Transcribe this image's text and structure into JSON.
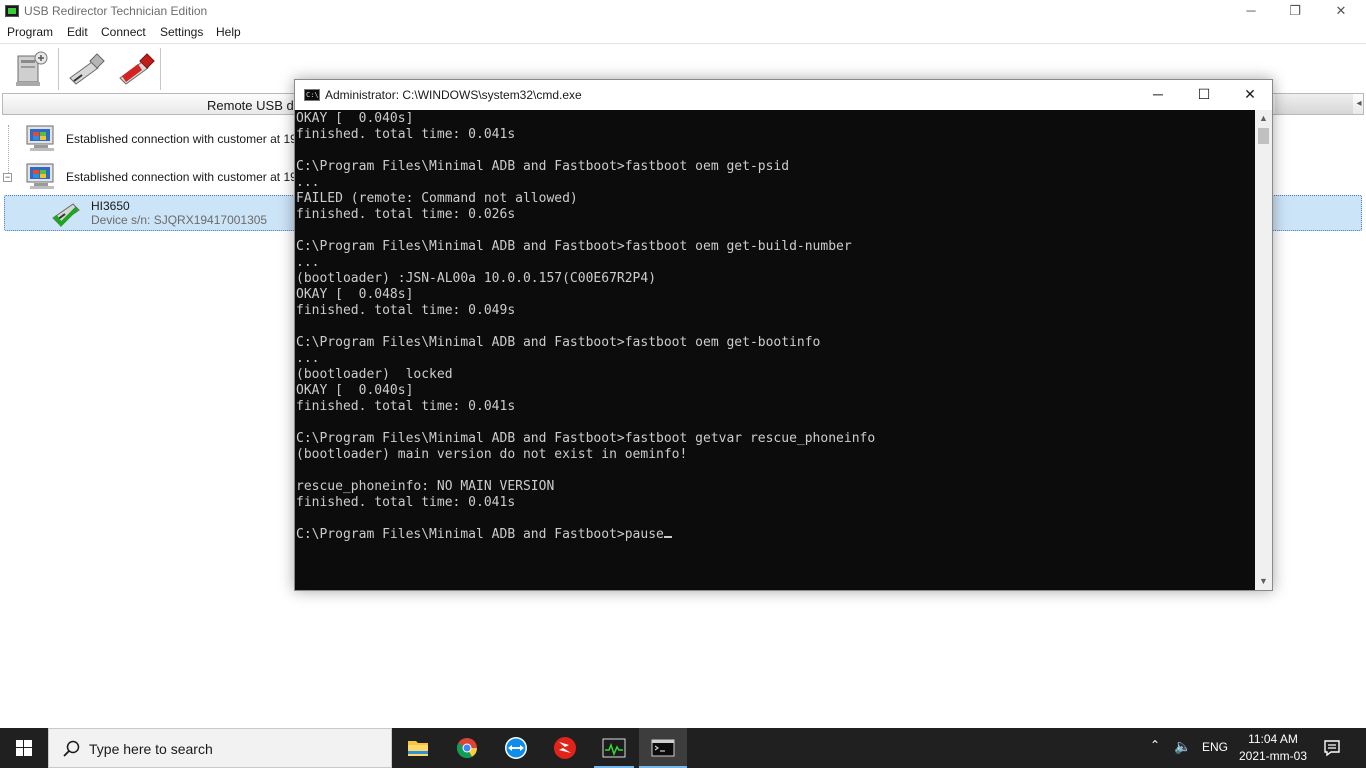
{
  "app": {
    "title": "USB Redirector Technician Edition",
    "controls": {
      "minimize": "─",
      "restore": "❐",
      "close": "✕"
    },
    "menu": [
      "Program",
      "Edit",
      "Connect",
      "Settings",
      "Help"
    ],
    "panel_header": "Remote USB d",
    "tree": [
      {
        "label": "Established connection with customer at 19"
      },
      {
        "label": "Established connection with customer at 19"
      }
    ],
    "expander": "−",
    "device": {
      "name": "HI3650",
      "serial": "Device s/n: SJQRX19417001305"
    },
    "header_arrow": "◂"
  },
  "cmd": {
    "title": "Administrator: C:\\WINDOWS\\system32\\cmd.exe",
    "icon_text": "C:\\",
    "controls": {
      "minimize": "─",
      "maximize": "☐",
      "close": "✕"
    },
    "scroll_up": "▲",
    "scroll_down": "▼",
    "lines": [
      "OKAY [  0.040s]",
      "finished. total time: 0.041s",
      "",
      "C:\\Program Files\\Minimal ADB and Fastboot>fastboot oem get-psid",
      "...",
      "FAILED (remote: Command not allowed)",
      "finished. total time: 0.026s",
      "",
      "C:\\Program Files\\Minimal ADB and Fastboot>fastboot oem get-build-number",
      "...",
      "(bootloader) :JSN-AL00a 10.0.0.157(C00E67R2P4)",
      "OKAY [  0.048s]",
      "finished. total time: 0.049s",
      "",
      "C:\\Program Files\\Minimal ADB and Fastboot>fastboot oem get-bootinfo",
      "...",
      "(bootloader)  locked",
      "OKAY [  0.040s]",
      "finished. total time: 0.041s",
      "",
      "C:\\Program Files\\Minimal ADB and Fastboot>fastboot getvar rescue_phoneinfo",
      "(bootloader) main version do not exist in oeminfo!",
      "",
      "rescue_phoneinfo: NO MAIN VERSION",
      "finished. total time: 0.041s",
      "",
      "C:\\Program Files\\Minimal ADB and Fastboot>pause"
    ]
  },
  "taskbar": {
    "search_placeholder": "Type here to search",
    "apps": [
      "file-explorer-icon",
      "chrome-icon",
      "teamviewer-icon",
      "snapdragon-icon",
      "task-manager-icon",
      "cmd-icon"
    ],
    "tray_chevron": "⌃",
    "tray_volume": "🔈",
    "language": "ENG",
    "time": "11:04 AM",
    "date": "2021-mm-03"
  }
}
